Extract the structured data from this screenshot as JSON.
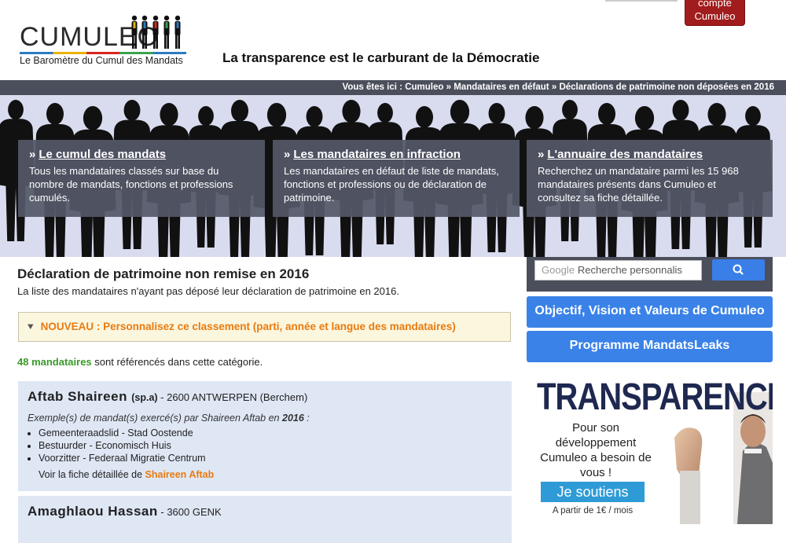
{
  "header": {
    "logo_word": "CUMULEO",
    "logo_subtitle": "Le Baromètre du Cumul des Mandats",
    "tagline": "La transparence est le carburant de la Démocratie",
    "account_line1": "compte",
    "account_line2": "Cumuleo"
  },
  "breadcrumb": {
    "prefix": "Vous êtes ici :",
    "items": [
      "Cumuleo",
      "Mandataires en défaut",
      "Déclarations de patrimoine non déposées en 2016"
    ],
    "separator": "»"
  },
  "cards": [
    {
      "title": "Le cumul des mandats",
      "text": "Tous les mandataires classés sur base du nombre de mandats, fonctions et professions cumulés."
    },
    {
      "title": "Les mandataires en infraction",
      "text": "Les mandataires en défaut de liste de mandats, fonctions et professions ou de déclaration de patrimoine."
    },
    {
      "title": "L'annuaire des mandataires",
      "text": "Recherchez un mandataire parmi les 15 968 mandataires présents dans Cumuleo et consultez sa fiche détaillée."
    }
  ],
  "main": {
    "title": "Déclaration de patrimoine non remise en 2016",
    "description": "La liste des mandataires n'ayant pas déposé leur déclaration de patrimoine en 2016.",
    "promo": "NOUVEAU : Personnalisez ce classement (parti, année et langue des mandataires)",
    "count_number": "48 mandataires",
    "count_text": " sont référencés dans cette catégorie.",
    "entries": [
      {
        "name": "Aftab Shaireen",
        "party": "(sp.a)",
        "location": " - 2600 ANTWERPEN (Berchem)",
        "example_prefix": "Exemple(s) de mandat(s) exercé(s) par Shaireen Aftab en ",
        "example_year": "2016",
        "example_suffix": " :",
        "mandates": [
          "Gemeenteraadslid - Stad Oostende",
          "Bestuurder - Economisch Huis",
          "Voorzitter - Federaal Migratie Centrum"
        ],
        "link_prefix": "Voir la fiche détaillée de ",
        "link_name": "Shaireen Aftab"
      },
      {
        "name": "Amaghlaou Hassan",
        "location": " - 3600 GENK"
      }
    ]
  },
  "sidebar": {
    "search_brand": "Google",
    "search_placeholder": "Recherche personnalis",
    "button1": "Objectif, Vision et Valeurs de Cumuleo",
    "button2": "Programme MandatsLeaks",
    "ad_title": "TRANSPARENCE",
    "ad_text": "Pour son développement Cumuleo a besoin de vous !",
    "ad_button": "Je soutiens",
    "ad_footer": "A partir de 1€ / mois"
  },
  "colors": {
    "breadcrumb_bg": "#4b4f5c",
    "accent_orange": "#e87b10",
    "accent_green": "#3a9a2a",
    "sidebar_button": "#3a82e8",
    "account_red": "#a11c1c",
    "entry_bg": "#dfe7f5"
  }
}
